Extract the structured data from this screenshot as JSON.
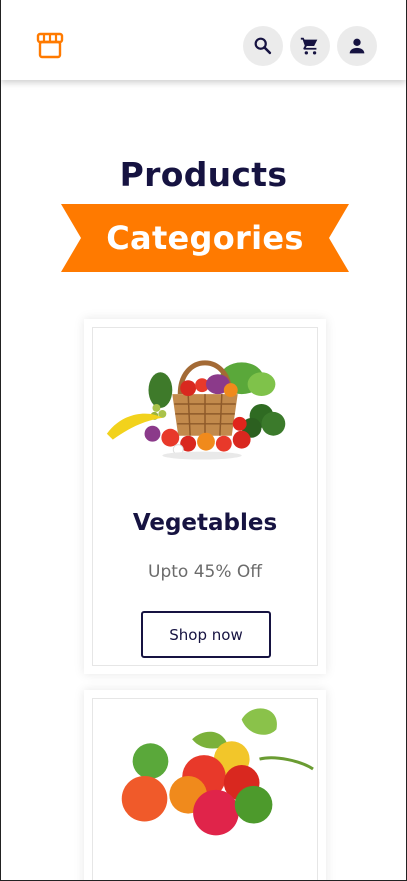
{
  "header": {
    "logo_icon": "storefront-icon",
    "accent": "#ff7a00",
    "actions": [
      {
        "name": "search",
        "icon": "search-icon"
      },
      {
        "name": "cart",
        "icon": "cart-icon"
      },
      {
        "name": "account",
        "icon": "user-icon"
      }
    ]
  },
  "section": {
    "title": "Products",
    "ribbon_label": "Categories",
    "title_color": "#161341",
    "ribbon_color": "#ff7a00"
  },
  "categories": [
    {
      "name": "Vegetables",
      "offer": "Upto 45% Off",
      "button_label": "Shop now",
      "image": "vegetable-basket"
    },
    {
      "name": "",
      "image": "fresh-fruits"
    }
  ]
}
